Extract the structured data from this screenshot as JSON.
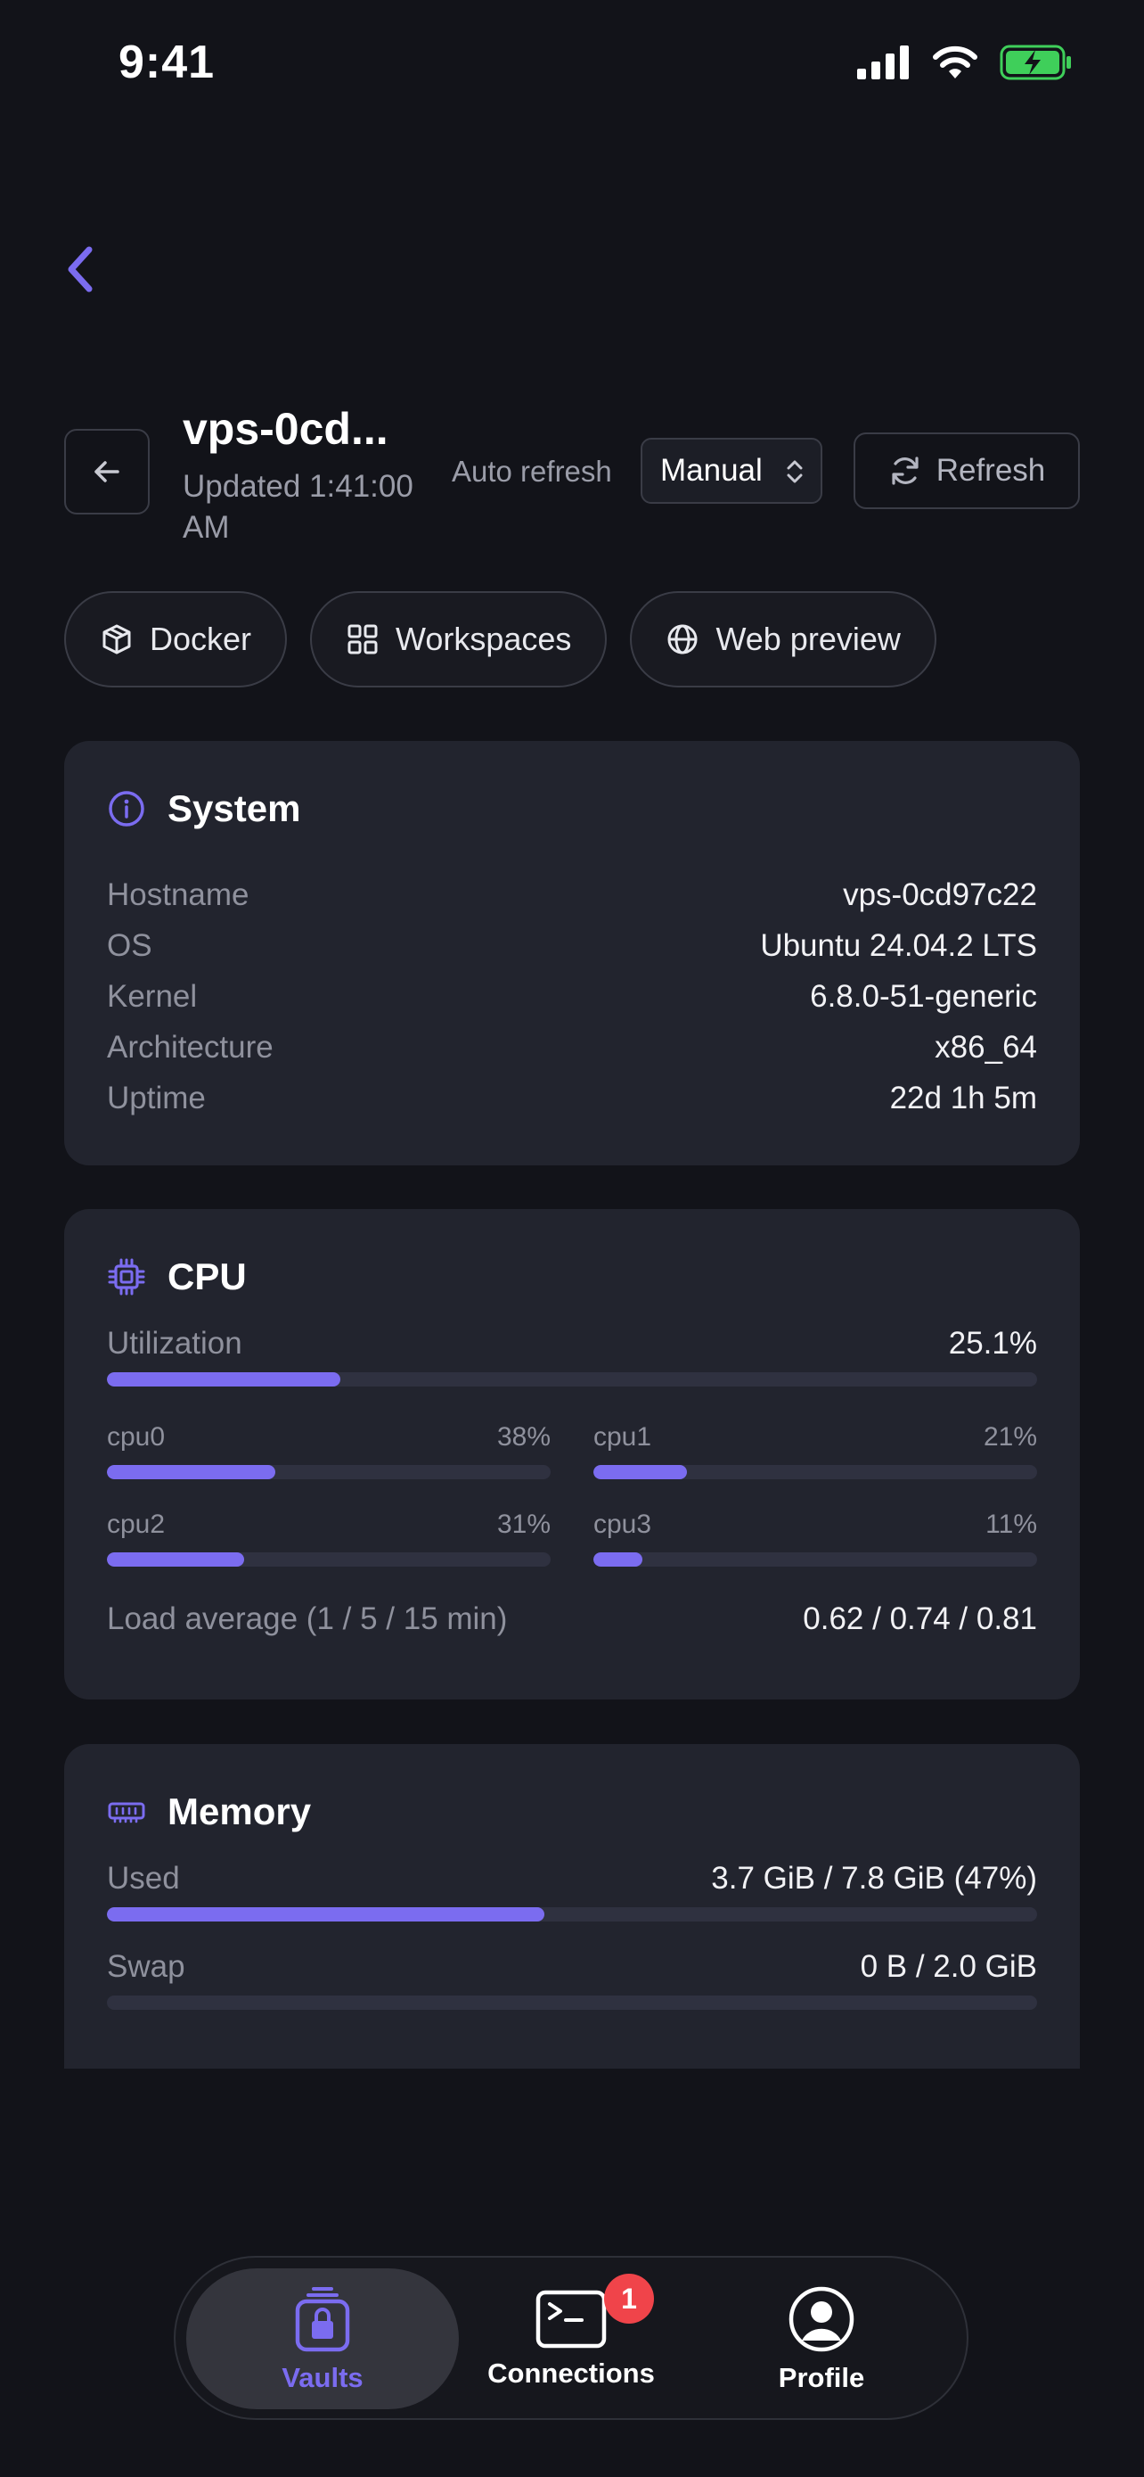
{
  "status_bar": {
    "time": "9:41"
  },
  "header": {
    "title": "vps-0cd...",
    "subtitle": "Updated 1:41:00 AM",
    "auto_refresh_label": "Auto refresh",
    "auto_refresh_value": "Manual",
    "refresh_label": "Refresh"
  },
  "chips": [
    {
      "label": "Docker",
      "icon": "cube-icon"
    },
    {
      "label": "Workspaces",
      "icon": "grid-icon"
    },
    {
      "label": "Web preview",
      "icon": "globe-icon"
    }
  ],
  "system": {
    "title": "System",
    "rows": [
      {
        "key": "Hostname",
        "value": "vps-0cd97c22"
      },
      {
        "key": "OS",
        "value": "Ubuntu 24.04.2 LTS"
      },
      {
        "key": "Kernel",
        "value": "6.8.0-51-generic"
      },
      {
        "key": "Architecture",
        "value": "x86_64"
      },
      {
        "key": "Uptime",
        "value": "22d 1h 5m"
      }
    ]
  },
  "cpu": {
    "title": "CPU",
    "utilization_label": "Utilization",
    "utilization_value": "25.1%",
    "utilization_fraction": 0.251,
    "cores": [
      {
        "name": "cpu0",
        "value": "38%",
        "fraction": 0.38
      },
      {
        "name": "cpu1",
        "value": "21%",
        "fraction": 0.21
      },
      {
        "name": "cpu2",
        "value": "31%",
        "fraction": 0.31
      },
      {
        "name": "cpu3",
        "value": "11%",
        "fraction": 0.11
      }
    ],
    "load_label": "Load average (1 / 5 / 15 min)",
    "load_value": "0.62 / 0.74 / 0.81"
  },
  "memory": {
    "title": "Memory",
    "used_label": "Used",
    "used_value": "3.7 GiB / 7.8 GiB (47%)",
    "used_fraction": 0.47,
    "swap_label": "Swap",
    "swap_value": "0 B / 2.0 GiB",
    "swap_fraction": 0
  },
  "tabbar": {
    "tabs": [
      {
        "label": "Vaults",
        "active": true
      },
      {
        "label": "Connections",
        "badge": "1"
      },
      {
        "label": "Profile"
      }
    ]
  },
  "colors": {
    "accent": "#7b6cf0",
    "background": "#121319",
    "card": "#22242e",
    "badge": "#f0444a"
  }
}
